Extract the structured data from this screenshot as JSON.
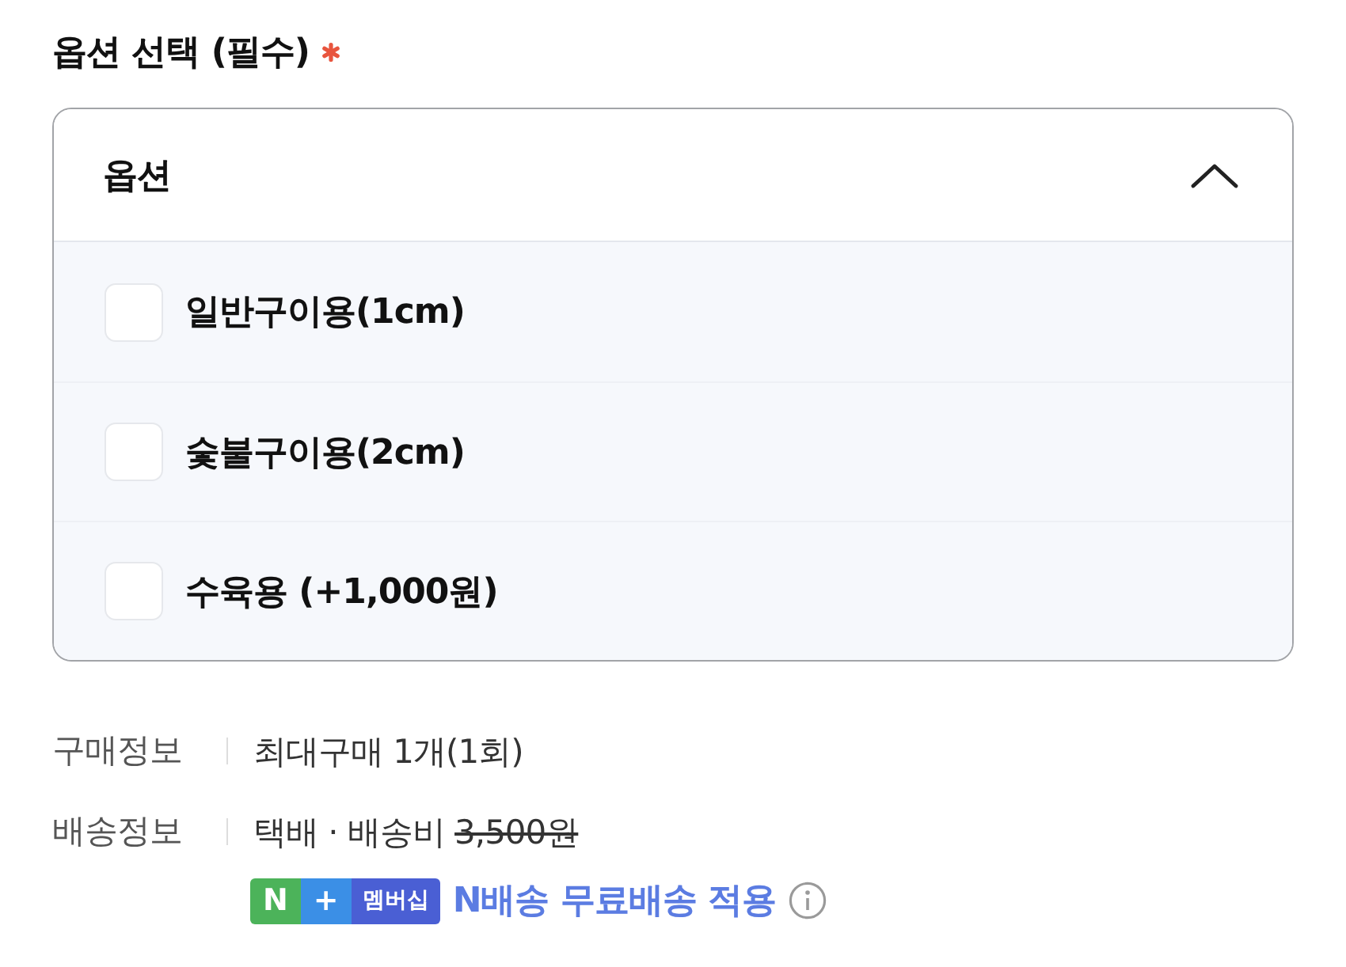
{
  "option_select": {
    "title": "옵션 선택 (필수)",
    "required": true
  },
  "dropdown": {
    "label": "옵션",
    "expanded": true,
    "options": [
      {
        "label": "일반구이용(1cm)",
        "checked": false
      },
      {
        "label": "숯불구이용(2cm)",
        "checked": false
      },
      {
        "label": "수육용 (+1,000원)",
        "checked": false
      }
    ]
  },
  "info_rows": [
    {
      "label": "구매정보",
      "value": "최대구매 1개(1회)"
    },
    {
      "label": "배송정보",
      "value": "택배 · 배송비",
      "original_fee": "3,500원",
      "fee_struck": true,
      "membership": {
        "badge": [
          {
            "text": "N",
            "color": "#4cb35a"
          },
          {
            "text": "+",
            "color": "#3b8fe6"
          },
          {
            "text": "멤버십",
            "color": "#4a5fd4"
          }
        ],
        "benefit": "N배송 무료배송 적용"
      }
    }
  ]
}
